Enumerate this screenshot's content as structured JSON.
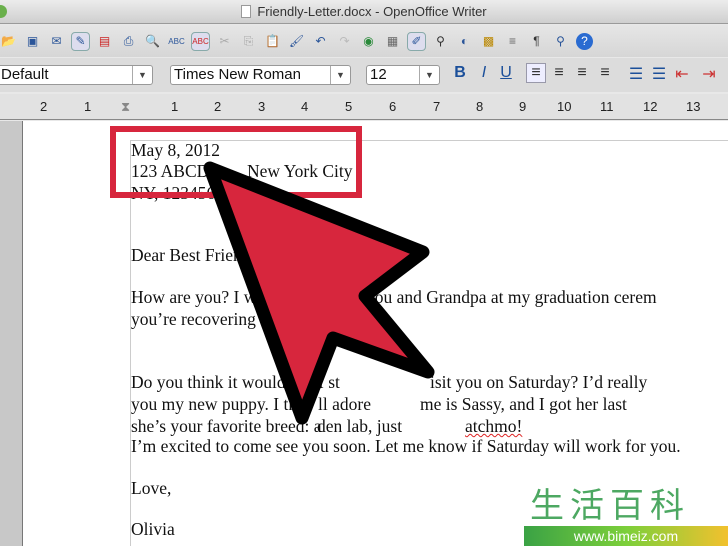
{
  "window": {
    "title": "Friendly-Letter.docx - OpenOffice Writer"
  },
  "toolbar": {
    "icons": [
      "open-icon",
      "save-icon",
      "email-icon",
      "edit-mode-icon",
      "export-pdf-icon",
      "print-icon",
      "print-preview-icon",
      "spellcheck-icon",
      "autospellcheck-icon",
      "cut-icon",
      "copy-icon",
      "paste-icon",
      "clone-format-icon",
      "undo-icon",
      "redo-icon",
      "navigator-icon",
      "table-icon",
      "draw-icon",
      "find-replace-icon",
      "hyperlink-icon",
      "gallery-icon",
      "data-sources-icon",
      "formatting-marks-icon",
      "zoom-icon",
      "help-icon"
    ]
  },
  "format": {
    "style": "Default",
    "font": "Times New Roman",
    "size": "12",
    "bold": "B",
    "italic": "I",
    "underline": "U"
  },
  "ruler": {
    "labels": [
      "2",
      "1",
      "1",
      "2",
      "3",
      "4",
      "5",
      "6",
      "7",
      "8",
      "9",
      "10",
      "11",
      "12",
      "13"
    ]
  },
  "letter": {
    "date": "May 8, 2012",
    "addr1_left": "123 ABCD",
    "addr1_right": "New York City",
    "addr2_left": "NY, 123456",
    "greeting": "Dear Best Friend",
    "p1l1_left": "How are you? I was",
    "p1l1_right": "you and Grandpa at my graduation cerem",
    "p1l2_left": "you’re recovering fro",
    "p2l1_left": "Do you think it would b",
    "p2l1_mid": "I st",
    "p2l1_right": "isit you on Saturday? I’d really",
    "p2l2_left": "you my new puppy. I thi",
    "p2l2_mid": "ll adore",
    "p2l2_right": "me is Sassy, and I got her last",
    "p2l3_left": "she’s your favorite breed: a",
    "p2l3_mid": "den lab, just",
    "p2l3_right": "atchmo!",
    "p3": "I’m excited to come see you soon. Let me know if Saturday will work for you.",
    "closing": "Love,",
    "signature": "Olivia"
  },
  "overlay": {
    "arrow_color": "#d7263d",
    "box_color": "#d7263d"
  },
  "watermark": {
    "chars": "生活百科",
    "url": "www.bimeiz.com"
  }
}
